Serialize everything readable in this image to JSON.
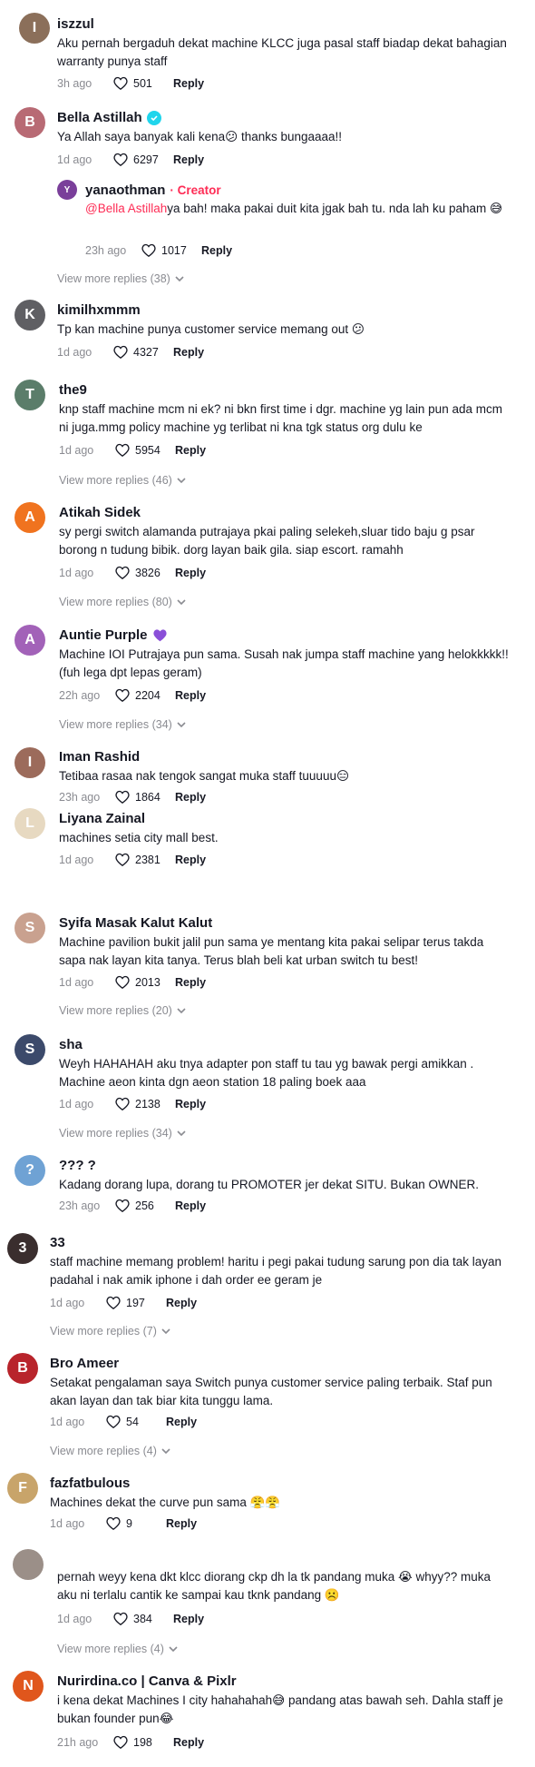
{
  "labels": {
    "reply": "Reply",
    "creator": "· Creator"
  },
  "comments": [
    {
      "username": "iszzul",
      "text": "Aku pernah bergaduh dekat machine KLCC juga pasal staff biadap dekat bahagian warranty punya staff",
      "time": "3h ago",
      "likes": "501",
      "avatar": {
        "initial": "I",
        "color": "#8b6f5a"
      }
    },
    {
      "username": "Bella Astillah",
      "text": "Ya Allah saya banyak kali kena😕 thanks bungaaaa!!",
      "time": "1d ago",
      "likes": "6297",
      "avatar": {
        "initial": "B",
        "color": "#b86a74"
      },
      "reply": {
        "username": "yanaothman",
        "mention": "@Bella Astillah",
        "text": "ya bah! maka pakai duit kita jgak bah tu. nda lah ku paham 😅",
        "time": "23h ago",
        "likes": "1017",
        "avatar": {
          "initial": "Y",
          "color": "#7a3f9a"
        }
      },
      "view_more": "View more replies (38)"
    },
    {
      "username": "kimilhxmmm",
      "text": "Tp kan machine punya customer service memang out 😕",
      "time": "1d ago",
      "likes": "4327",
      "avatar": {
        "initial": "K",
        "color": "#5f5f63"
      }
    },
    {
      "username": "the9",
      "text": "knp staff machine mcm ni ek? ni bkn first time i dgr. machine yg lain pun ada mcm ni juga.mmg policy machine yg terlibat ni kna tgk status org dulu ke",
      "time": "1d ago",
      "likes": "5954",
      "avatar": {
        "initial": "T",
        "color": "#5b7d6a"
      },
      "view_more": "View more replies (46)"
    },
    {
      "username": "Atikah Sidek",
      "text": "sy pergi switch alamanda putrajaya pkai paling selekeh,sluar tido baju g psar borong n tudung bibik. dorg layan baik gila. siap escort. ramahh",
      "time": "1d ago",
      "likes": "3826",
      "avatar": {
        "initial": "A",
        "color": "#f0731f"
      },
      "view_more": "View more replies (80)"
    },
    {
      "username": "Auntie Purple",
      "text": "Machine IOI Putrajaya pun sama. Susah nak jumpa staff machine yang helokkkkk!! (fuh lega dpt lepas geram)",
      "time": "22h ago",
      "likes": "2204",
      "avatar": {
        "initial": "A",
        "color": "#a262b8"
      },
      "view_more": "View more replies (34)"
    },
    {
      "username": "Iman Rashid",
      "text": "Tetibaa rasaa nak tengok sangat muka staff tuuuuu😑",
      "time": "23h ago",
      "likes": "1864",
      "avatar": {
        "initial": "I",
        "color": "#9c6b5b"
      }
    },
    {
      "username": "Liyana Zainal",
      "text": "machines setia city mall best.",
      "time": "1d ago",
      "likes": "2381",
      "avatar": {
        "initial": "L",
        "color": "#e7d9c1"
      }
    },
    {
      "username": "Syifa Masak Kalut Kalut",
      "text": "Machine pavilion bukit jalil pun sama ye mentang kita pakai selipar terus takda sapa nak layan kita tanya. Terus blah beli kat urban switch tu best!",
      "time": "1d ago",
      "likes": "2013",
      "avatar": {
        "initial": "S",
        "color": "#c9a18f"
      },
      "view_more": "View more replies (20)"
    },
    {
      "username": "sha",
      "text": "Weyh HAHAHAH aku tnya adapter pon staff tu tau yg bawak pergi amikkan . Machine aeon kinta dgn aeon station 18 paling boek aaa",
      "time": "1d ago",
      "likes": "2138",
      "avatar": {
        "initial": "S",
        "color": "#3c4a6b"
      },
      "view_more": "View more replies (34)"
    },
    {
      "username": "??? ?",
      "text": "Kadang dorang lupa, dorang tu PROMOTER jer dekat SITU. Bukan OWNER.",
      "time": "23h ago",
      "likes": "256",
      "avatar": {
        "initial": "?",
        "color": "#6fa2d4"
      }
    },
    {
      "username": "33",
      "text": "staff machine memang problem! haritu i pegi pakai tudung sarung pon dia tak layan padahal i nak amik iphone i dah order ee geram je",
      "time": "1d ago",
      "likes": "197",
      "avatar": {
        "initial": "3",
        "color": "#3a2e2e"
      },
      "view_more": "View more replies (7)"
    },
    {
      "username": "Bro Ameer",
      "text": "Setakat pengalaman saya Switch punya customer service paling terbaik. Staf pun akan layan dan tak biar kita tunggu lama.",
      "time": "1d ago",
      "likes": "54",
      "avatar": {
        "initial": "B",
        "color": "#b8242b"
      },
      "view_more": "View more replies (4)"
    },
    {
      "username": "fazfatbulous",
      "text": "Machines dekat the curve pun sama 😤😤",
      "time": "1d ago",
      "likes": "9",
      "avatar": {
        "initial": "F",
        "color": "#c8a46a"
      }
    },
    {
      "username": "",
      "text": "pernah weyy kena dkt klcc diorang ckp dh la tk pandang muka 😭 whyy?? muka aku ni terlalu cantik ke sampai kau tknk pandang ☹️",
      "time": "1d ago",
      "likes": "384",
      "avatar": {
        "initial": "",
        "color": "#9b8f88"
      },
      "view_more": "View more replies (4)"
    },
    {
      "username": "Nurirdina.co | Canva & Pixlr",
      "text": "i kena dekat Machines I city hahahahah😅 pandang atas bawah seh. Dahla staff je bukan founder pun😂",
      "time": "21h ago",
      "likes": "198",
      "avatar": {
        "initial": "N",
        "color": "#e0561c"
      }
    }
  ]
}
